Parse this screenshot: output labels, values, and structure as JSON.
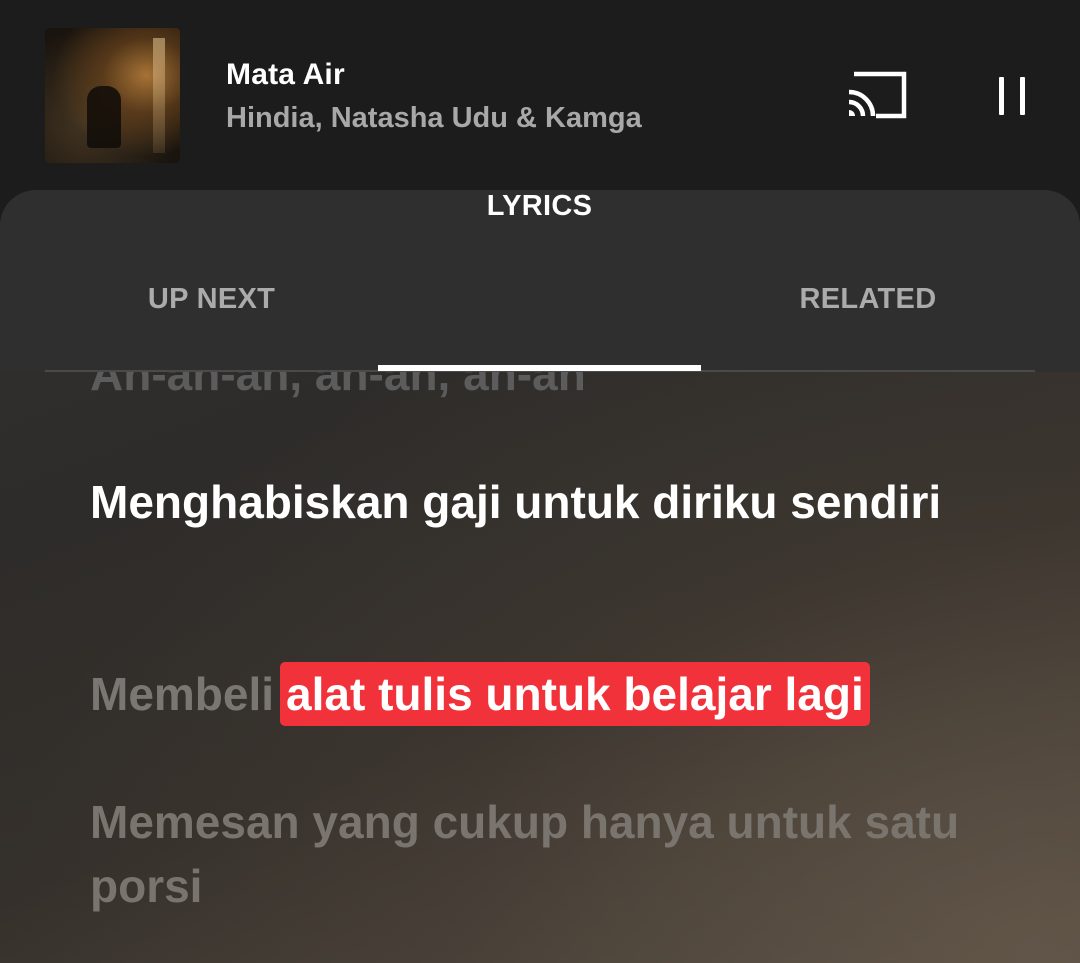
{
  "player": {
    "title": "Mata Air",
    "artist": "Hindia, Natasha Udu & Kamga",
    "album_art_icon": "album-art-image",
    "cast_icon": "cast-icon",
    "pause_icon": "pause-icon"
  },
  "tabs": [
    {
      "label": "UP NEXT",
      "active": false
    },
    {
      "label": "LYRICS",
      "active": true
    },
    {
      "label": "RELATED",
      "active": false
    }
  ],
  "lyrics": {
    "previous": "Ah-ah-ah, ah-ah, ah-ah",
    "current": "Menghabiskan gaji untuk diriku sendiri",
    "next_prefix": "Membeli",
    "next_highlight": "alat tulis untuk belajar lagi",
    "later": "Memesan yang cukup hanya untuk satu porsi"
  },
  "colors": {
    "accent_highlight": "#f2323a",
    "background": "#1c1c1c",
    "active_tab": "#ffffff",
    "inactive_tab": "#ababab"
  }
}
